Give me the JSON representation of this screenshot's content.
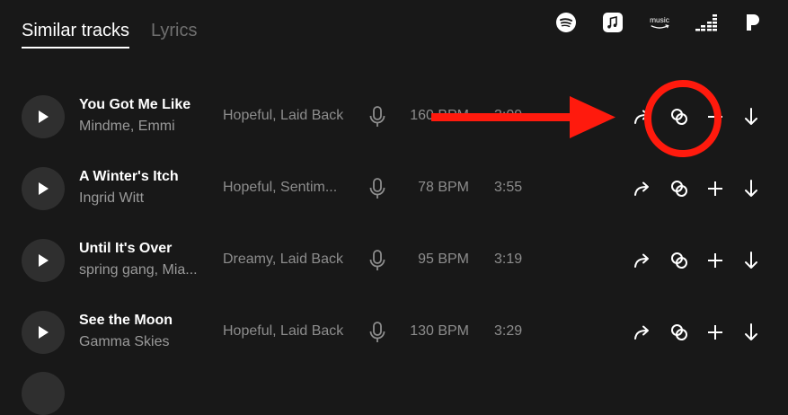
{
  "tabs": [
    {
      "label": "Similar tracks",
      "active": true
    },
    {
      "label": "Lyrics",
      "active": false
    }
  ],
  "services": [
    "spotify-icon",
    "apple-music-icon",
    "amazon-music-icon",
    "deezer-icon",
    "pandora-icon"
  ],
  "services_text": {
    "amazon_music": "music"
  },
  "tracks": [
    {
      "title": "You Got Me Like",
      "artist": "Mindme, Emmi",
      "mood": "Hopeful, Laid Back",
      "bpm": "160 BPM",
      "duration": "3:09"
    },
    {
      "title": "A Winter's Itch",
      "artist": "Ingrid Witt",
      "mood": "Hopeful, Sentim...",
      "bpm": "78 BPM",
      "duration": "3:55"
    },
    {
      "title": "Until It's Over",
      "artist": "spring gang, Mia...",
      "mood": "Dreamy, Laid Back",
      "bpm": "95 BPM",
      "duration": "3:19"
    },
    {
      "title": "See the Moon",
      "artist": "Gamma Skies",
      "mood": "Hopeful, Laid Back",
      "bpm": "130 BPM",
      "duration": "3:29"
    }
  ],
  "colors": {
    "background": "#181818",
    "annotation": "#ff1a0d",
    "muted_text": "#8d8d8d"
  }
}
